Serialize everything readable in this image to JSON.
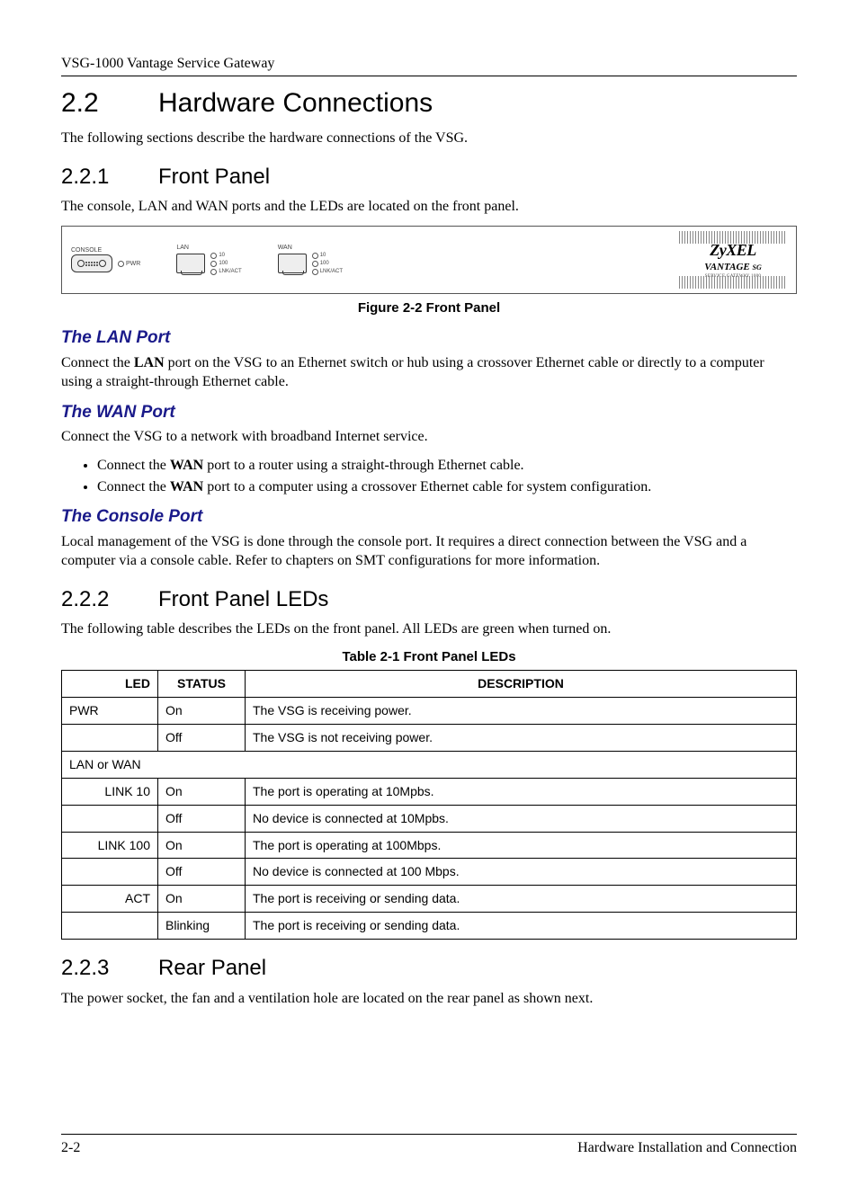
{
  "header": {
    "doc_title": "VSG-1000 Vantage Service Gateway"
  },
  "s22": {
    "num": "2.2",
    "title": "Hardware Connections",
    "intro": "The following sections describe the hardware connections of the VSG."
  },
  "s221": {
    "num": "2.2.1",
    "title": "Front Panel",
    "intro": "The console, LAN and WAN ports and the LEDs are located on the front panel."
  },
  "figure": {
    "caption": "Figure 2-2 Front Panel",
    "console_label": "CONSOLE",
    "pwr_label": "PWR",
    "lan_label": "LAN",
    "wan_label": "WAN",
    "led10": "10",
    "led100": "100",
    "ledact": "LNK/ACT",
    "brand": "ZyXEL",
    "brand_sub": "VANTAGE",
    "brand_sg": "SG",
    "brand_tag": "SERVICE GATEWAY 1000"
  },
  "lan": {
    "title": "The LAN Port",
    "text_pre": "Connect the ",
    "text_bold": "LAN",
    "text_post": " port on the VSG to an Ethernet switch or hub using a crossover Ethernet cable or directly to a computer using a straight-through Ethernet cable."
  },
  "wan": {
    "title": "The WAN Port",
    "intro": "Connect the VSG to a network with broadband Internet service.",
    "b1_pre": "Connect the ",
    "b1_bold": "WAN",
    "b1_post": " port to a router using a straight-through Ethernet cable.",
    "b2_pre": "Connect the ",
    "b2_bold": "WAN",
    "b2_post": " port to a computer using a crossover Ethernet cable for system configuration."
  },
  "console": {
    "title": "The Console Port",
    "text": "Local management of the VSG is done through the console port. It requires a direct connection between the VSG and a computer via a console cable. Refer to chapters on SMT configurations for more information."
  },
  "s222": {
    "num": "2.2.2",
    "title": "Front Panel LEDs",
    "intro": "The following table describes the LEDs on the front panel. All LEDs are green when turned on."
  },
  "table": {
    "caption": "Table 2-1 Front Panel LEDs",
    "h_led": "LED",
    "h_status": "STATUS",
    "h_desc": "DESCRIPTION",
    "r1": {
      "led": "PWR",
      "status": "On",
      "desc": "The VSG is receiving power."
    },
    "r2": {
      "status": "Off",
      "desc": "The VSG is not receiving power."
    },
    "group": "LAN or WAN",
    "r3": {
      "led": "LINK 10",
      "status": "On",
      "desc": "The port is operating at 10Mpbs."
    },
    "r4": {
      "status": "Off",
      "desc": "No device is connected at 10Mpbs."
    },
    "r5": {
      "led": "LINK 100",
      "status": "On",
      "desc": "The port is operating at 100Mbps."
    },
    "r6": {
      "status": "Off",
      "desc": "No device is connected at 100 Mbps."
    },
    "r7": {
      "led": "ACT",
      "status": "On",
      "desc": "The port is receiving or sending data."
    },
    "r8": {
      "status": "Blinking",
      "desc": "The port is receiving or sending data."
    }
  },
  "s223": {
    "num": "2.2.3",
    "title": "Rear Panel",
    "intro": "The power socket, the fan and a ventilation hole are located on the rear panel as shown next."
  },
  "footer": {
    "page": "2-2",
    "chapter": "Hardware Installation and Connection"
  }
}
